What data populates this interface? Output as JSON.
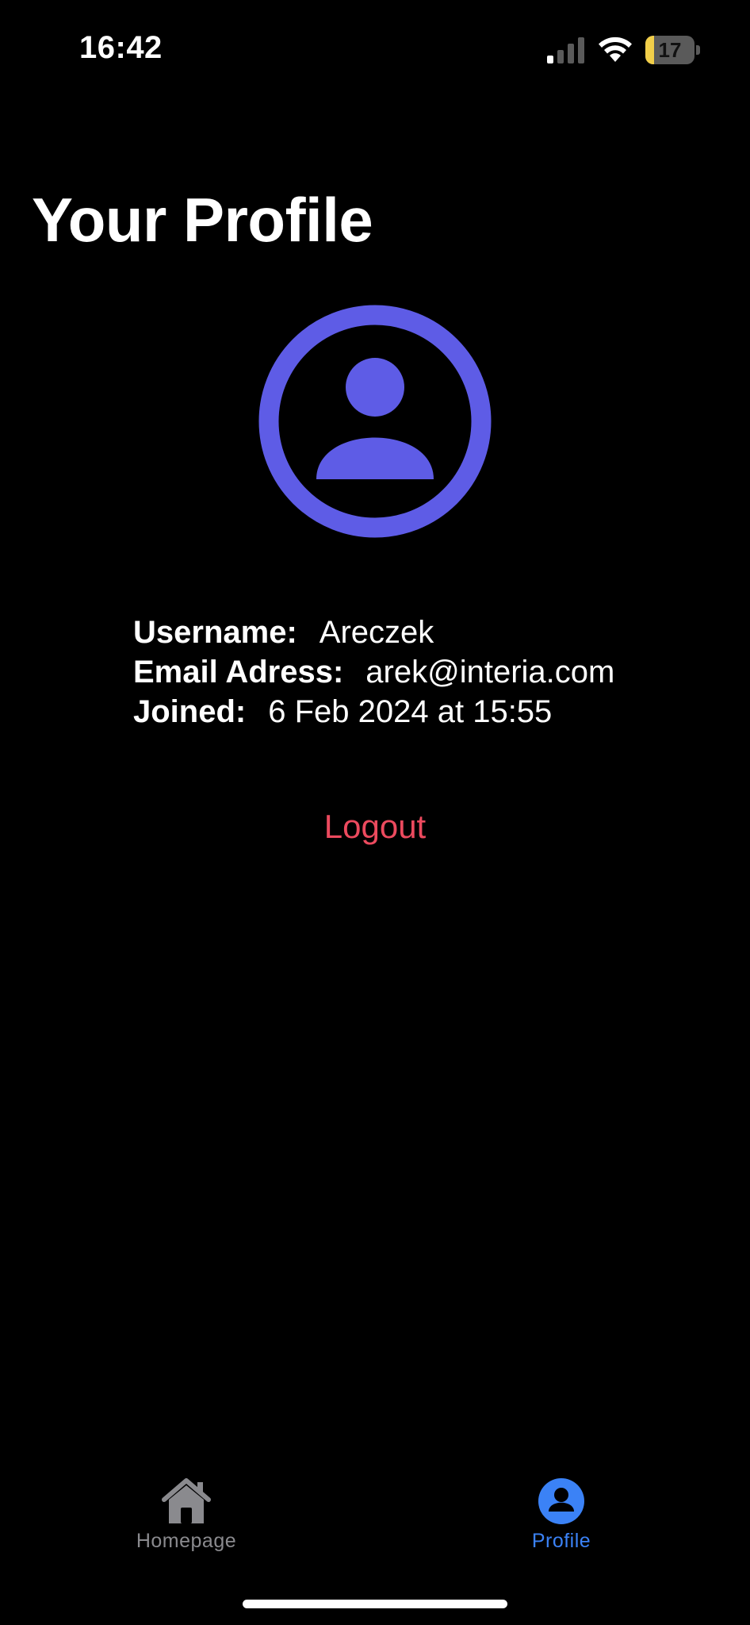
{
  "status_bar": {
    "time": "16:42",
    "battery_level": "17",
    "battery_fraction": 0.17,
    "icons": [
      "signal-icon",
      "wifi-icon",
      "battery-charging-icon"
    ]
  },
  "page": {
    "title": "Your Profile"
  },
  "avatar": {
    "icon": "person-circle-icon",
    "color": "#5e5ce6"
  },
  "profile": {
    "username_label": "Username:",
    "username_value": "Areczek",
    "email_label": "Email Adress:",
    "email_value": "arek@interia.com",
    "joined_label": "Joined:",
    "joined_value": "6 Feb 2024 at 15:55"
  },
  "actions": {
    "logout_label": "Logout",
    "logout_color": "#ec4a5e"
  },
  "tab_bar": {
    "tabs": [
      {
        "label": "Homepage",
        "icon": "house-icon",
        "selected": false
      },
      {
        "label": "Profile",
        "icon": "person-circle-fill-icon",
        "selected": true
      }
    ],
    "selected_color": "#3b82f6",
    "unselected_color": "#8a8a8e"
  }
}
